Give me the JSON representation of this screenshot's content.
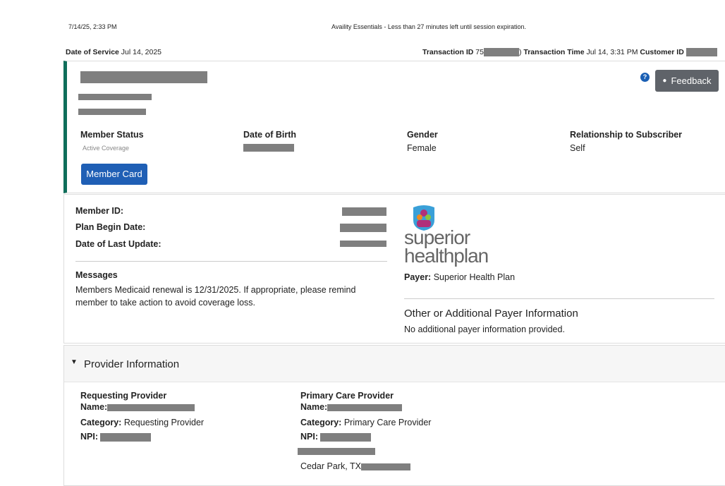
{
  "print_header": {
    "timestamp": "7/14/25, 2:33 PM",
    "title": "Availity Essentials - Less than 27 minutes left until session expiration."
  },
  "meta": {
    "dos_label": "Date of Service",
    "dos": "Jul 14, 2025",
    "txn_id_label": "Transaction ID",
    "txn_id_visible": "75",
    "txn_id_tail": ")",
    "txn_time_label": "Transaction Time",
    "txn_time": "Jul 14, 3:31 PM",
    "customer_id_label": "Customer ID"
  },
  "member": {
    "status_label": "Member Status",
    "status": "Active Coverage",
    "dob_label": "Date of Birth",
    "gender_label": "Gender",
    "gender": "Female",
    "rel_label": "Relationship to Subscriber",
    "rel": "Self",
    "card_button": "Member Card",
    "feedback_button": "Feedback",
    "help": "?"
  },
  "plan": {
    "member_id_label": "Member ID:",
    "begin_label": "Plan Begin Date:",
    "update_label": "Date of Last Update:",
    "messages_title": "Messages",
    "message": "Members Medicaid renewal is 12/31/2025. If appropriate, please remind member to take action to avoid coverage loss.",
    "logo_line1": "superior",
    "logo_line2": "healthplan",
    "payer_label": "Payer:",
    "payer": "Superior Health Plan",
    "other_title": "Other or Additional Payer Information",
    "other_text": "No additional payer information provided."
  },
  "provider": {
    "section_title": "Provider Information",
    "requesting": {
      "title": "Requesting Provider",
      "name_label": "Name:",
      "category_label": "Category:",
      "category": "Requesting Provider",
      "npi_label": "NPI:"
    },
    "pcp": {
      "title": "Primary Care Provider",
      "name_label": "Name:",
      "category_label": "Category:",
      "category": "Primary Care Provider",
      "npi_label": "NPI:",
      "city": "Cedar Park, TX"
    }
  }
}
